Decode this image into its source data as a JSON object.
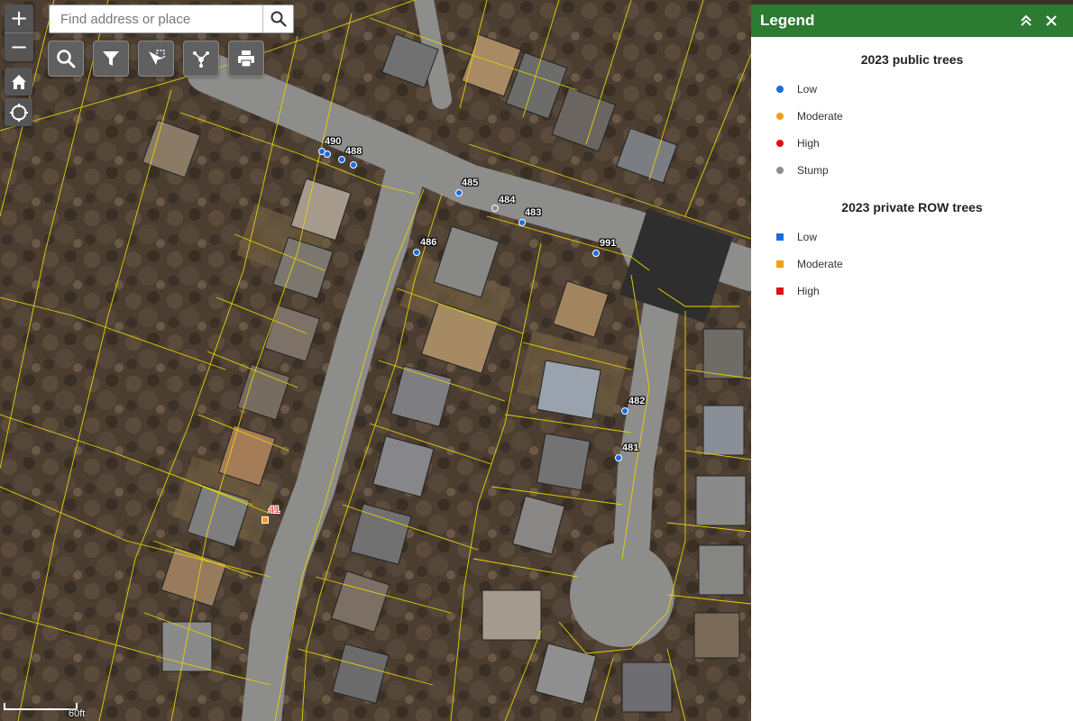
{
  "search": {
    "placeholder": "Find address or place"
  },
  "zoom": {
    "in_label": "+",
    "out_label": "−"
  },
  "toolbar": [
    "search-icon",
    "filter-icon",
    "select-icon",
    "share-icon",
    "print-icon"
  ],
  "map": {
    "scale_label": "60ft",
    "public_trees": [
      {
        "id": "490",
        "condition": "Low"
      },
      {
        "id": "488",
        "condition": "Low"
      },
      {
        "id": "485",
        "condition": "Low"
      },
      {
        "id": "484",
        "condition": "Stump"
      },
      {
        "id": "483",
        "condition": "Low"
      },
      {
        "id": "486",
        "condition": "Low"
      },
      {
        "id": "991",
        "condition": "Low"
      },
      {
        "id": "482",
        "condition": "Low"
      },
      {
        "id": "481",
        "condition": "Low"
      }
    ],
    "private_trees": [
      {
        "id": "41",
        "condition": "Moderate"
      }
    ]
  },
  "legend": {
    "title": "Legend",
    "public_title": "2023 public trees",
    "public_items": [
      {
        "label": "Low",
        "color": "#1a6be0"
      },
      {
        "label": "Moderate",
        "color": "#f0a010"
      },
      {
        "label": "High",
        "color": "#e01010"
      },
      {
        "label": "Stump",
        "color": "#8c8c8c"
      }
    ],
    "private_title": "2023 private ROW trees",
    "private_items": [
      {
        "label": "Low",
        "color": "#1a6be0"
      },
      {
        "label": "Moderate",
        "color": "#f0a010"
      },
      {
        "label": "High",
        "color": "#e01010"
      }
    ]
  },
  "colors": {
    "header_green": "#2d7a33",
    "parcel_line": "#e6d200",
    "Low": "#1a6be0",
    "Moderate": "#f0a010",
    "High": "#e01010",
    "Stump": "#8c8c8c"
  }
}
